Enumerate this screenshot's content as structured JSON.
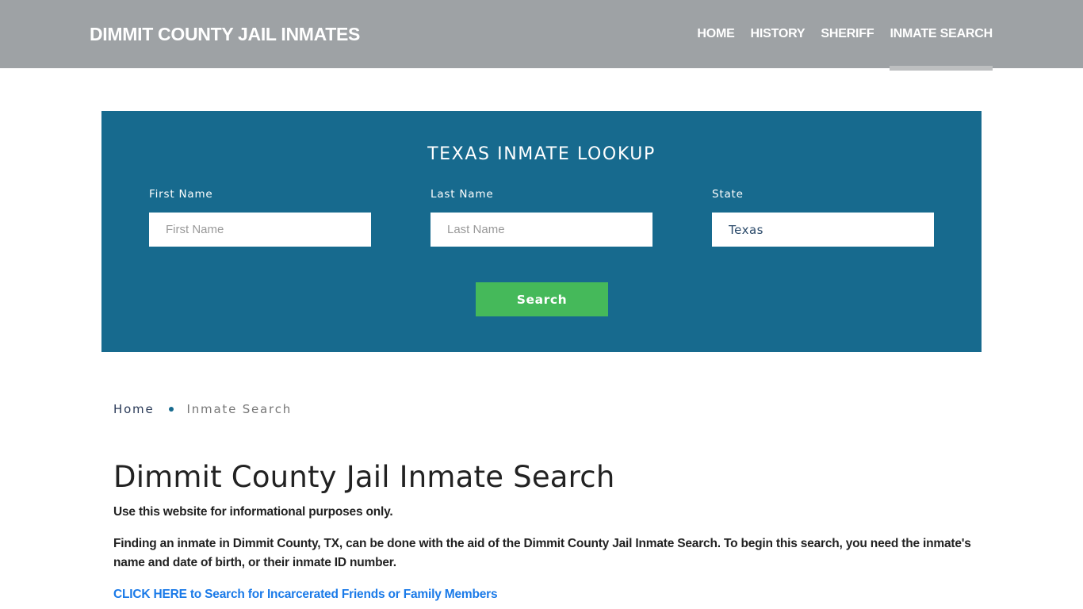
{
  "header": {
    "brand": "DIMMIT COUNTY JAIL INMATES",
    "nav": [
      {
        "label": "HOME",
        "active": false
      },
      {
        "label": "HISTORY",
        "active": false
      },
      {
        "label": "SHERIFF",
        "active": false
      },
      {
        "label": "INMATE SEARCH",
        "active": true
      }
    ]
  },
  "lookup": {
    "title": "TEXAS INMATE LOOKUP",
    "fields": {
      "first_name": {
        "label": "First Name",
        "placeholder": "First Name",
        "value": ""
      },
      "last_name": {
        "label": "Last Name",
        "placeholder": "Last Name",
        "value": ""
      },
      "state": {
        "label": "State",
        "value": "Texas"
      }
    },
    "search_label": "Search"
  },
  "breadcrumb": {
    "home": "Home",
    "current": "Inmate Search"
  },
  "content": {
    "title": "Dimmit County Jail Inmate Search",
    "disclaimer": "Use this website for informational purposes only.",
    "intro": "Finding an inmate in Dimmit County, TX, can be done with the aid of the Dimmit County Jail Inmate Search. To begin this search, you need the inmate's name and date of birth, or their inmate ID number.",
    "cta": "CLICK HERE to Search for Incarcerated Friends or Family Members"
  },
  "colors": {
    "header_bg": "#9ea2a5",
    "lookup_bg": "#176a8e",
    "search_button": "#45b95a",
    "link": "#1a7ae8"
  }
}
